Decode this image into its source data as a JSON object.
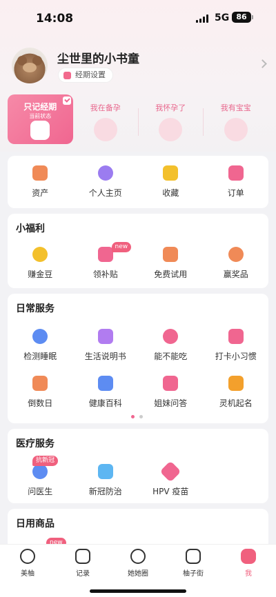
{
  "status": {
    "time": "14:08",
    "network": "5G",
    "battery": "86"
  },
  "profile": {
    "username": "尘世里的小书童",
    "period_button": "经期设置"
  },
  "modes": [
    {
      "label": "只记经期",
      "sub": "当前状态",
      "active": true
    },
    {
      "label": "我在备孕"
    },
    {
      "label": "我怀孕了"
    },
    {
      "label": "我有宝宝"
    }
  ],
  "quick": [
    {
      "label": "资产",
      "icon": "wallet-icon",
      "color": "#f08a57"
    },
    {
      "label": "个人主页",
      "icon": "person-icon",
      "color": "#9b7cf0"
    },
    {
      "label": "收藏",
      "icon": "star-icon",
      "color": "#f3c02c"
    },
    {
      "label": "订单",
      "icon": "order-icon",
      "color": "#f06690"
    }
  ],
  "welfare": {
    "title": "小福利",
    "items": [
      {
        "label": "赚金豆",
        "icon": "bean-icon",
        "color": "#f3c02c"
      },
      {
        "label": "领补贴",
        "icon": "coupon-icon",
        "color": "#f06690",
        "badge": "new"
      },
      {
        "label": "免费试用",
        "icon": "trial-icon",
        "color": "#f08a57"
      },
      {
        "label": "赢奖品",
        "icon": "prize-icon",
        "color": "#f08a57"
      }
    ]
  },
  "daily": {
    "title": "日常服务",
    "row1": [
      {
        "label": "检测睡眠",
        "icon": "sleep-icon",
        "color": "#5d8cf2"
      },
      {
        "label": "生活说明书",
        "icon": "guide-icon",
        "color": "#b17cf0"
      },
      {
        "label": "能不能吃",
        "icon": "food-question-icon",
        "color": "#f06690"
      },
      {
        "label": "打卡小习惯",
        "icon": "checkin-icon",
        "color": "#f06690"
      }
    ],
    "row2": [
      {
        "label": "倒数日",
        "icon": "day-countdown-icon",
        "color": "#f08a57"
      },
      {
        "label": "健康百科",
        "icon": "encyclopedia-icon",
        "color": "#5d8cf2"
      },
      {
        "label": "姐妹问答",
        "icon": "question-icon",
        "color": "#f06690"
      },
      {
        "label": "灵机起名",
        "icon": "naming-icon",
        "color": "#f3a02c"
      }
    ]
  },
  "medical": {
    "title": "医疗服务",
    "items": [
      {
        "label": "问医生",
        "icon": "doctor-icon",
        "color": "#5d8cf2",
        "badge": "抗新冠"
      },
      {
        "label": "新冠防治",
        "icon": "shield-icon",
        "color": "#5db6f2"
      },
      {
        "label": "HPV 疫苗",
        "icon": "vaccine-icon",
        "color": "#f06690"
      }
    ]
  },
  "goods": {
    "title": "日用商品",
    "badge": "new"
  },
  "tabs": [
    {
      "label": "美柚",
      "icon": "meiyou-icon"
    },
    {
      "label": "记录",
      "icon": "calendar-icon"
    },
    {
      "label": "她她圈",
      "icon": "community-icon"
    },
    {
      "label": "柚子街",
      "icon": "shop-bag-icon"
    },
    {
      "label": "我",
      "icon": "me-icon",
      "active": true
    }
  ]
}
